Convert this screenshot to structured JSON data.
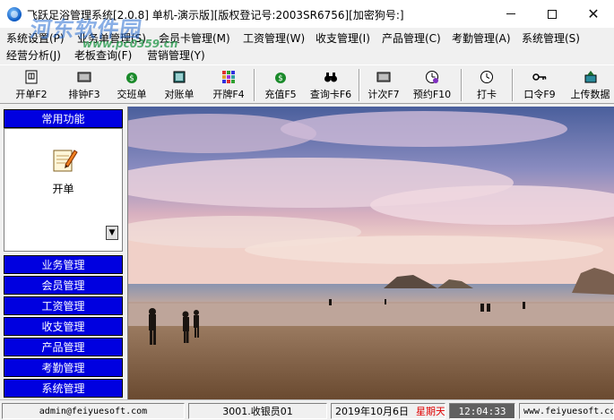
{
  "window": {
    "title": "飞跃足浴管理系统[2.0.8] 单机-演示版][版权登记号:2003SR6756][加密狗号:]",
    "min_glyph": "—",
    "close_glyph": "✕"
  },
  "watermark": {
    "main": "河东软件园",
    "url": "www.pc0359.cn"
  },
  "menu": {
    "row1": [
      "系统设置(P)",
      "业务单管理(S)",
      "会员卡管理(M)",
      "工资管理(W)",
      "收支管理(I)",
      "产品管理(C)",
      "考勤管理(A)",
      "系统管理(S)"
    ],
    "row2": [
      "经营分析(J)",
      "老板查询(F)",
      "营销管理(Y)"
    ]
  },
  "toolbar": {
    "buttons": [
      {
        "label": "开单F2",
        "icon": "open-bill-icon"
      },
      {
        "label": "排钟F3",
        "icon": "schedule-icon"
      },
      {
        "label": "交班单",
        "icon": "handover-icon"
      },
      {
        "label": "对账单",
        "icon": "statement-icon"
      },
      {
        "label": "开牌F4",
        "icon": "card-grid-icon"
      },
      {
        "label": "充值F5",
        "icon": "recharge-icon"
      },
      {
        "label": "查询卡F6",
        "icon": "binoculars-icon"
      },
      {
        "label": "计次F7",
        "icon": "counter-icon"
      },
      {
        "label": "预约F10",
        "icon": "appointment-icon"
      },
      {
        "label": "打卡",
        "icon": "clock-icon"
      },
      {
        "label": "口令F9",
        "icon": "key-icon"
      },
      {
        "label": "上传数据",
        "icon": "upload-icon"
      }
    ]
  },
  "left_panel": {
    "common_header": "常用功能",
    "kaidan_label": "开单",
    "scroll_glyph": "▼",
    "sections": [
      "业务管理",
      "会员管理",
      "工资管理",
      "收支管理",
      "产品管理",
      "考勤管理",
      "系统管理"
    ]
  },
  "status_bar": {
    "email": "admin@feiyuesoft.com",
    "user": "3001.收银员01",
    "date": "2019年10月6日",
    "weekday": "星期天",
    "time": "12:04:33",
    "website": "www.feiyuesoft.cc"
  },
  "colors": {
    "panel_blue": "#0000e0",
    "weekday_red": "#e00000",
    "time_bg": "#606060"
  }
}
